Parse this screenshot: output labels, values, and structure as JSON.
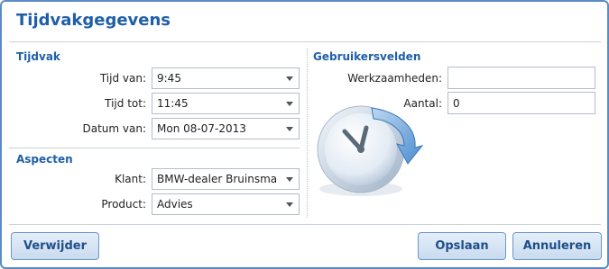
{
  "dialog": {
    "title": "Tijdvakgegevens"
  },
  "tijdvak": {
    "heading": "Tijdvak",
    "tijd_van": {
      "label": "Tijd van:",
      "value": "9:45"
    },
    "tijd_tot": {
      "label": "Tijd tot:",
      "value": "11:45"
    },
    "datum_van": {
      "label": "Datum van:",
      "value": "Mon 08-07-2013"
    }
  },
  "aspecten": {
    "heading": "Aspecten",
    "klant": {
      "label": "Klant:",
      "value": "BMW-dealer Bruinsma"
    },
    "product": {
      "label": "Product:",
      "value": "Advies"
    }
  },
  "gebruikersvelden": {
    "heading": "Gebruikersvelden",
    "werkzaamheden": {
      "label": "Werkzaamheden:",
      "value": ""
    },
    "aantal": {
      "label": "Aantal:",
      "value": "0"
    }
  },
  "buttons": {
    "delete": "Verwijder",
    "save": "Opslaan",
    "cancel": "Annuleren"
  },
  "icons": {
    "illustration": "clock-refresh-icon"
  },
  "colors": {
    "accent": "#1f5fa8",
    "border": "#5b8bc7",
    "button_top": "#e4eef9",
    "button_bottom": "#c9dbef"
  }
}
